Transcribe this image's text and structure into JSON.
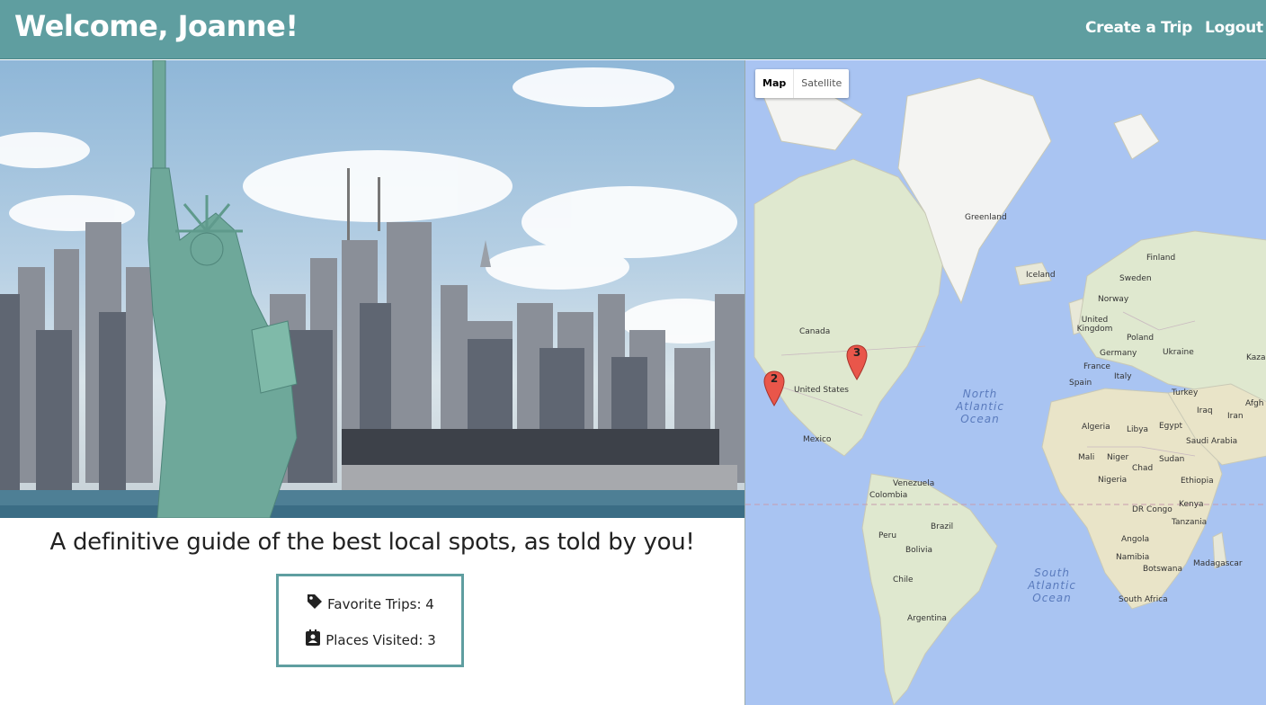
{
  "navbar": {
    "welcome": "Welcome, Joanne!",
    "create_trip": "Create a Trip",
    "logout": "Logout"
  },
  "hero": {
    "image": "new-york-skyline-statue-of-liberty"
  },
  "tagline": "A definitive guide of the best local spots, as told by you!",
  "stats": {
    "favorite_trips": "Favorite Trips: 4",
    "places_visited": "Places Visited: 3",
    "favorite_icon": "tag-icon",
    "places_icon": "contact-card-icon"
  },
  "map": {
    "map_type_active": "Map",
    "map_type_other": "Satellite",
    "countries": {
      "greenland": "Greenland",
      "iceland": "Iceland",
      "finland": "Finland",
      "sweden": "Sweden",
      "norway": "Norway",
      "united_kingdom": "United Kingdom",
      "poland": "Poland",
      "germany": "Germany",
      "ukraine": "Ukraine",
      "kaza": "Kaza",
      "france": "France",
      "spain": "Spain",
      "italy": "Italy",
      "turkey": "Turkey",
      "iraq": "Iraq",
      "afgh": "Afgh",
      "iran": "Iran",
      "canada": "Canada",
      "united_states": "United States",
      "mexico": "Mexico",
      "algeria": "Algeria",
      "libya": "Libya",
      "egypt": "Egypt",
      "saudi_arabia": "Saudi Arabia",
      "mali": "Mali",
      "niger": "Niger",
      "chad": "Chad",
      "sudan": "Sudan",
      "nigeria": "Nigeria",
      "ethiopia": "Ethiopia",
      "venezuela": "Venezuela",
      "colombia": "Colombia",
      "dr_congo": "DR Congo",
      "kenya": "Kenya",
      "tanzania": "Tanzania",
      "brazil": "Brazil",
      "peru": "Peru",
      "bolivia": "Bolivia",
      "angola": "Angola",
      "namibia": "Namibia",
      "botswana": "Botswana",
      "madagascar": "Madagascar",
      "chile": "Chile",
      "south_africa": "South Africa",
      "argentina": "Argentina"
    },
    "oceans": {
      "north_atlantic": "North Atlantic Ocean",
      "south_atlantic": "South Atlantic Ocean"
    },
    "markers": [
      {
        "label": "2"
      },
      {
        "label": "3"
      }
    ],
    "colors": {
      "water": "#a9c4f2",
      "land": "#e8e8d8",
      "marker": "#e9564a"
    }
  },
  "colors": {
    "navbar": "#5f9ea0",
    "accent_border": "#5f9ea0"
  }
}
